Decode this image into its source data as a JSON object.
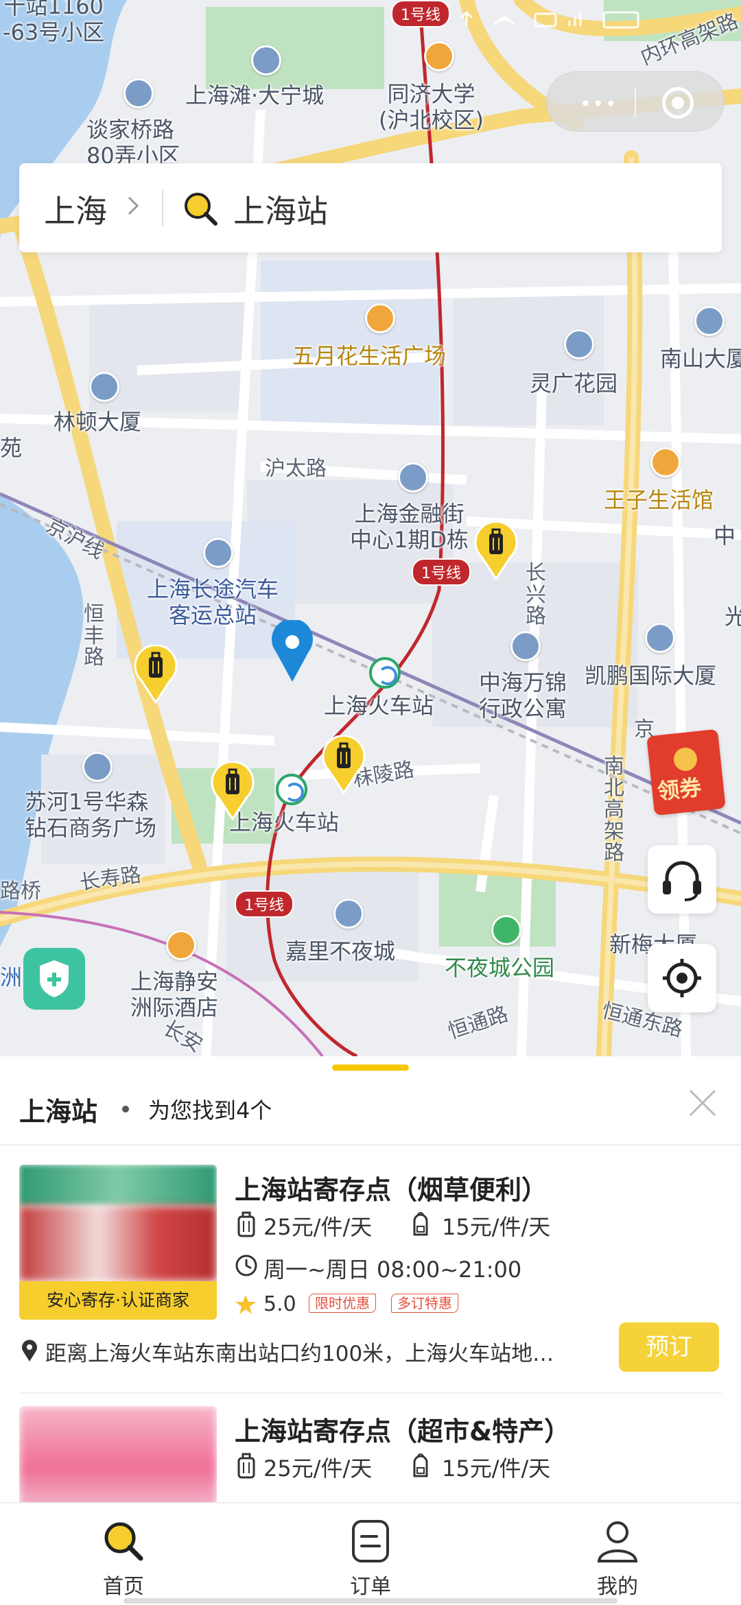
{
  "map": {
    "line_label": "1号线",
    "labels": {
      "corner_top": "十站1160\n-63号小区",
      "tanjiaqiao": "谈家桥路\n80弄小区",
      "shanghaitan": "上海滩·大宁城",
      "tongji": "同济大学\n(沪北校区)",
      "inner_ring": "内环高架路",
      "wuyuehua": "五月花生活广场",
      "lingguang": "灵广花园",
      "nanshan": "南山大厦",
      "lindun": "林顿大厦",
      "yuan": "苑",
      "hutai": "沪太路",
      "wangzi": "王子生活馆",
      "jinrongjie": "上海金融街\n中心1期D栋",
      "zhong": "中",
      "jinghu": "京沪线",
      "changxing": "长兴路",
      "changtu": "上海长途汽车\n客运总站",
      "hengfeng": "恒丰路",
      "guang": "光",
      "zhonghai": "中海万锦\n行政公寓",
      "kaipeng": "凯鹏国际大厦",
      "railway_station_1": "上海火车站",
      "jing": "京",
      "nanbei": "南北高架路",
      "molin": "秣陵路",
      "suhe": "苏河1号华森\n钻石商务广场",
      "railway_station_2": "上海火车站",
      "lujiao": "路桥",
      "changshou": "长寿路",
      "xinmei": "新梅大厦",
      "jiali": "嘉里不夜城",
      "buyecheng_park": "不夜城公园",
      "jingan_hotel": "上海静安\n洲际酒店",
      "zhou": "洲",
      "chang": "长安",
      "hengtong": "恒通路",
      "hengtong_east": "恒通东路"
    }
  },
  "capsule": {
    "more": "•••"
  },
  "search": {
    "city": "上海",
    "query": "上海站"
  },
  "coupon": {
    "label": "领券"
  },
  "results": {
    "title": "上海站",
    "count_text": "为您找到4个"
  },
  "stores": [
    {
      "name": "上海站寄存点（烟草便利）",
      "price_luggage": "25元/件/天",
      "price_bag": "15元/件/天",
      "hours": "周一~周日 08:00~21:00",
      "badge": "安心寄存·认证商家",
      "rating": "5.0",
      "tags": [
        "限时优惠",
        "多订特惠"
      ],
      "address": "距离上海火车站东南出站口约100米，上海火车站地…",
      "book_label": "预订"
    },
    {
      "name": "上海站寄存点（超市&特产）",
      "price_luggage": "25元/件/天",
      "price_bag": "15元/件/天"
    }
  ],
  "tabs": [
    {
      "label": "首页",
      "icon": "search-icon",
      "active": true
    },
    {
      "label": "订单",
      "icon": "order-icon",
      "active": false
    },
    {
      "label": "我的",
      "icon": "user-icon",
      "active": false
    }
  ],
  "colors": {
    "accent": "#f6ce2d",
    "metro_line": "#c0272d",
    "tag_red": "#e6503d",
    "location_pin": "#1e88d8"
  }
}
